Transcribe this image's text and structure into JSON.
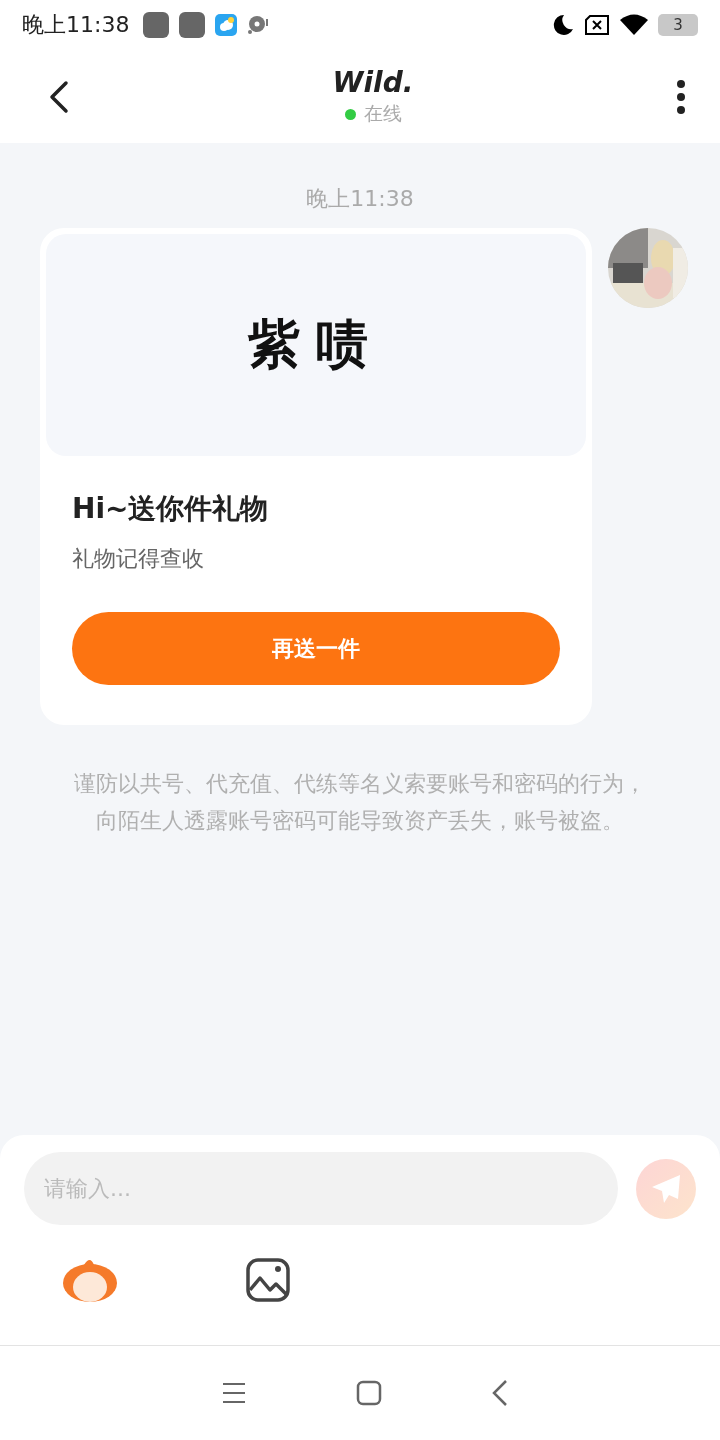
{
  "status_bar": {
    "time": "晚上11:38",
    "battery": "3"
  },
  "header": {
    "title": "Wild.",
    "status": "在线",
    "online": true
  },
  "messages": [
    {
      "kind": "timestamp",
      "text": "晚上11:38"
    },
    {
      "kind": "gift",
      "gift_name": "紫啧",
      "title": "Hi~送你件礼物",
      "subtitle": "礼物记得查收",
      "button": "再送一件"
    },
    {
      "kind": "notice",
      "text": "谨防以共号、代充值、代练等名义索要账号和密码的行为，向陌生人透露账号密码可能导致资产丢失，账号被盗。"
    }
  ],
  "composer": {
    "placeholder": "请输入..."
  }
}
